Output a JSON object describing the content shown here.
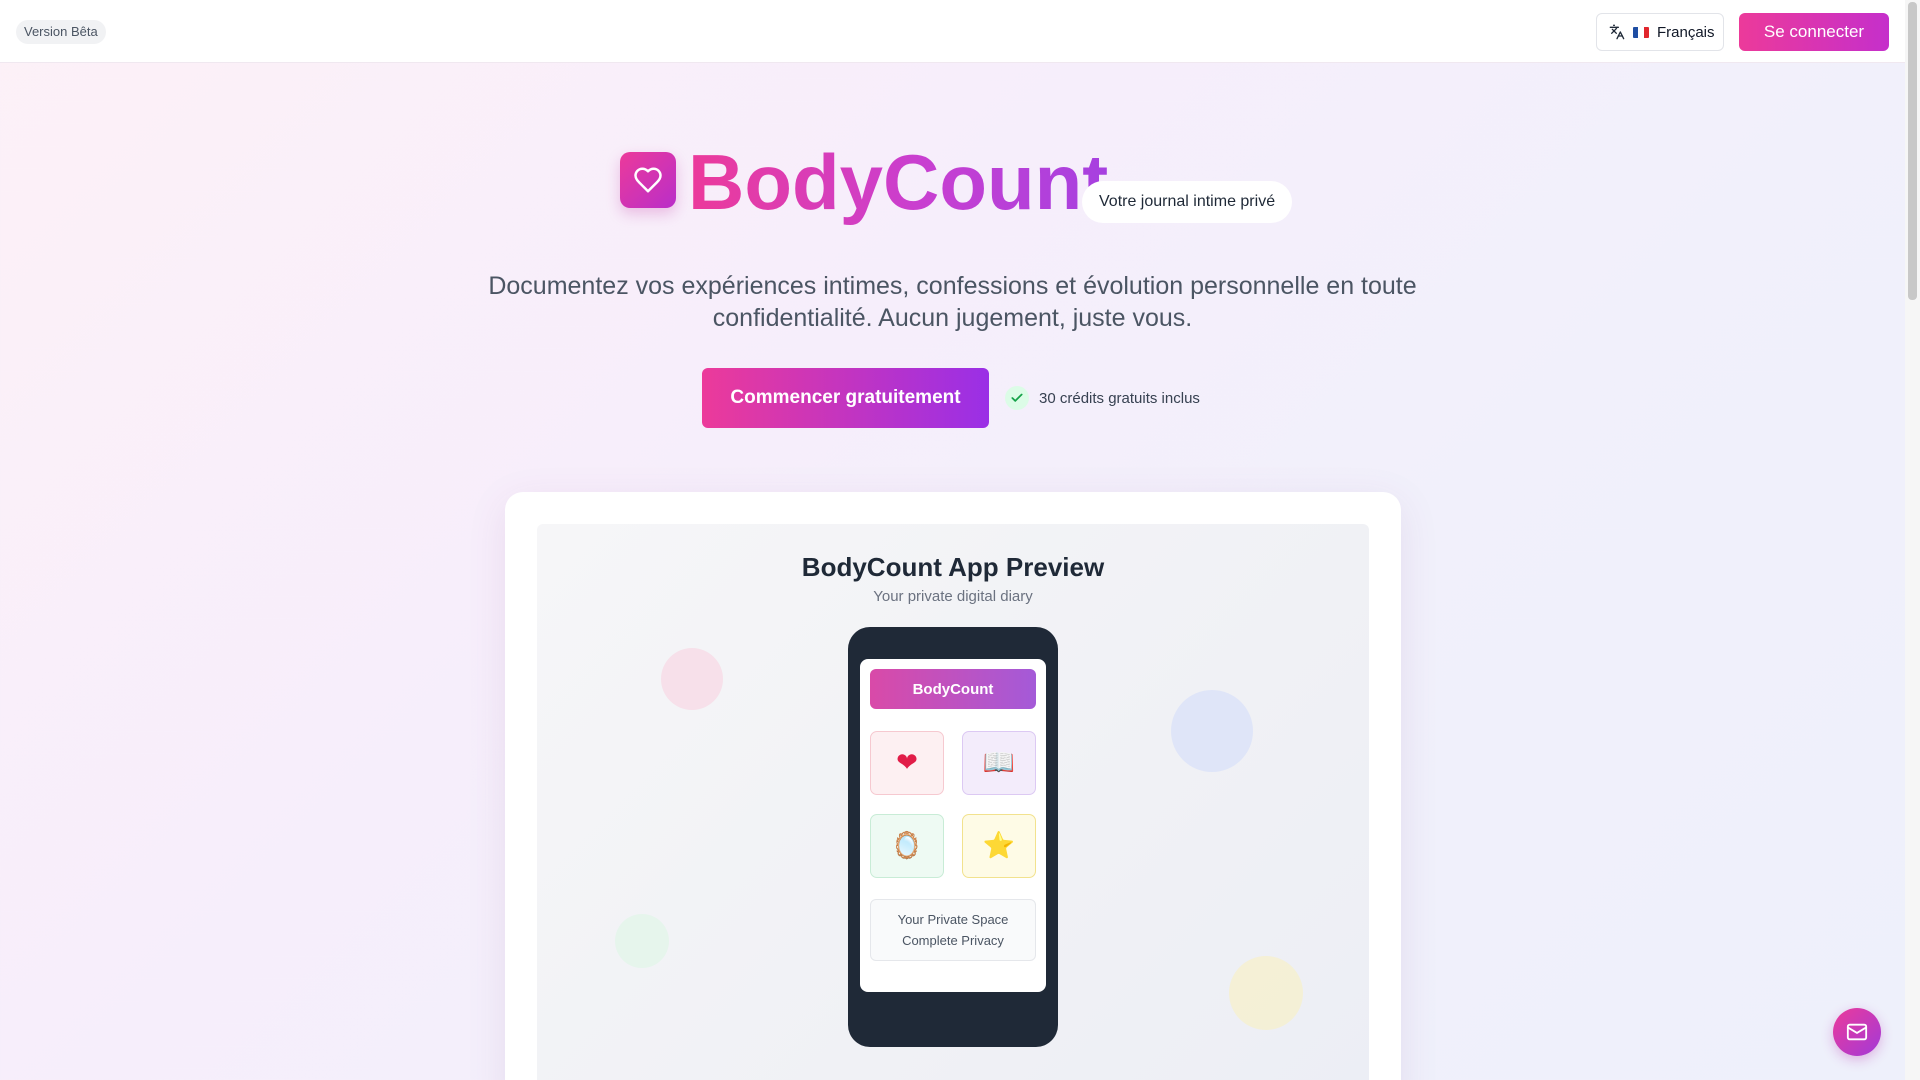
{
  "header": {
    "beta_label": "Version Bêta",
    "language_label": "Français",
    "login_label": "Se connecter"
  },
  "hero": {
    "brand": "BodyCount",
    "tagline": "Votre journal intime privé",
    "description": "Documentez vos expériences intimes, confessions et évolution personnelle en toute confidentialité. Aucun jugement, juste vous.",
    "cta_label": "Commencer gratuitement",
    "credits_note": "30 crédits gratuits inclus"
  },
  "preview": {
    "title": "BodyCount App Preview",
    "subtitle": "Your private digital diary",
    "app_header": "BodyCount",
    "tiles": [
      {
        "icon": "heart-icon",
        "glyph": "❤"
      },
      {
        "icon": "book-icon",
        "glyph": "📖"
      },
      {
        "icon": "mirror-icon",
        "glyph": "🪞"
      },
      {
        "icon": "star-icon",
        "glyph": "⭐"
      }
    ],
    "privacy_line1": "Your Private Space",
    "privacy_line2": "Complete Privacy"
  },
  "colors": {
    "brand_pink": "#ec3a9a",
    "brand_purple": "#9a2fe6",
    "text_dark": "#1f2937"
  },
  "icons": {
    "language": "translate-icon",
    "logo": "heart-outline-icon",
    "credits": "check-icon",
    "fab": "mail-icon"
  }
}
